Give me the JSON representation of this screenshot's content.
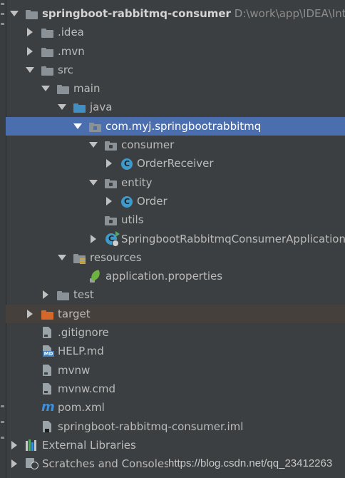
{
  "project": {
    "name": "springboot-rabbitmq-consumer",
    "path": "D:\\work\\app\\IDEA\\Intelli"
  },
  "tree": {
    "idea": ".idea",
    "mvn": ".mvn",
    "src": "src",
    "main": "main",
    "java": "java",
    "package": "com.myj.springbootrabbitmq",
    "consumer": "consumer",
    "order_receiver": "OrderReceiver",
    "entity": "entity",
    "order": "Order",
    "utils": "utils",
    "application_class": "SpringbootRabbitmqConsumerApplication",
    "resources": "resources",
    "application_properties": "application.properties",
    "test": "test",
    "target": "target",
    "gitignore": ".gitignore",
    "help_md": "HELP.md",
    "mvnw": "mvnw",
    "mvnw_cmd": "mvnw.cmd",
    "pom": "pom.xml",
    "iml": "springboot-rabbitmq-consumer.iml",
    "external_libraries": "External Libraries",
    "scratches": "Scratches and Consoles"
  },
  "icons": {
    "class_letter": "C",
    "maven_letter": "m",
    "md_badge": "MD"
  },
  "watermark": "https://blog.csdn.net/qq_23412263",
  "colors": {
    "background": "#3c3f41",
    "selection": "#4b6eaf",
    "folder_blue": "#3f8fc5",
    "folder_orange": "#d4682a",
    "class_icon": "#3d9acb"
  }
}
